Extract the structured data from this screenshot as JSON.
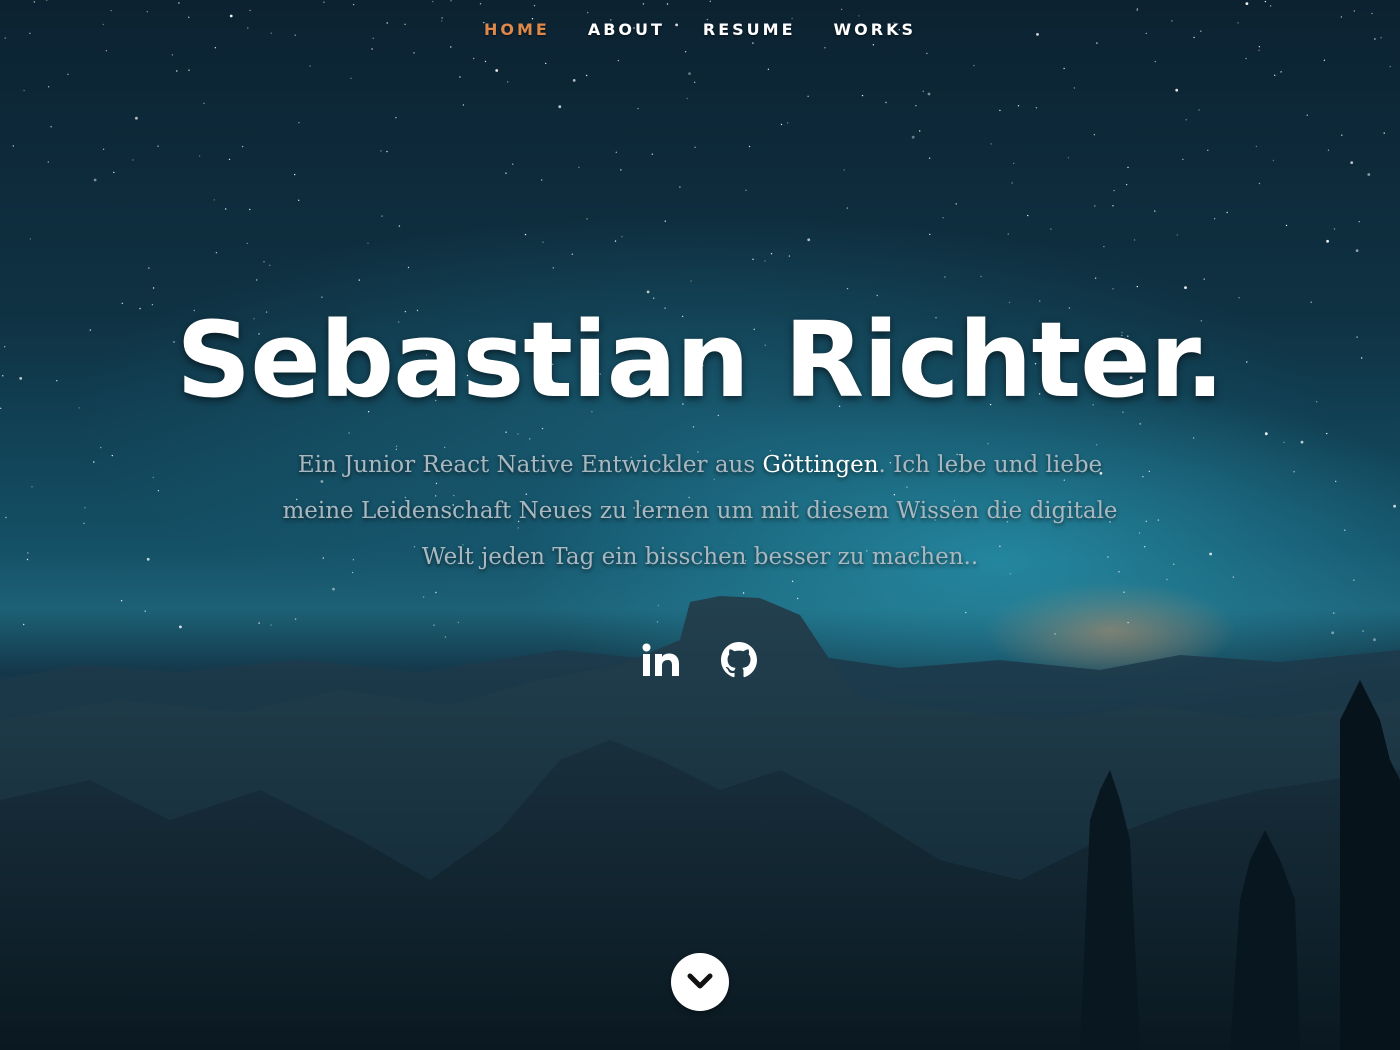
{
  "nav": {
    "items": [
      {
        "label": "HOME",
        "active": true
      },
      {
        "label": "ABOUT",
        "active": false
      },
      {
        "label": "RESUME",
        "active": false
      },
      {
        "label": "WORKS",
        "active": false
      }
    ]
  },
  "hero": {
    "title": "Sebastian Richter.",
    "text_before": "Ein Junior React Native Entwickler aus ",
    "text_highlight": "Göttingen",
    "text_after": ". Ich lebe und liebe meine Leidenschaft Neues zu lernen um mit diesem Wissen die digitale Welt jeden Tag ein bisschen besser zu machen.."
  },
  "social": [
    {
      "name": "linkedin",
      "icon": "linkedin-icon"
    },
    {
      "name": "github",
      "icon": "github-icon"
    }
  ],
  "scroll_down": {
    "icon": "chevron-down-icon"
  },
  "colors": {
    "accent": "#e0884a",
    "text_muted": "#a9b8c0",
    "white": "#ffffff"
  }
}
